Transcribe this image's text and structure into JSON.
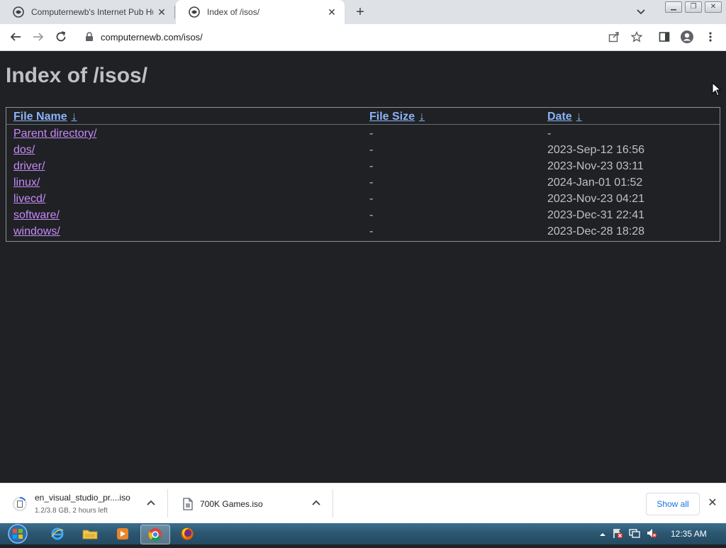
{
  "browser": {
    "tabs": [
      {
        "title": "Computernewb's Internet Pub Hub",
        "active": false
      },
      {
        "title": "Index of /isos/",
        "active": true
      }
    ],
    "url": "computernewb.com/isos/"
  },
  "page": {
    "heading": "Index of /isos/",
    "columns": {
      "name": "File Name",
      "size": "File Size",
      "date": "Date",
      "sort_arrow": "↓"
    },
    "rows": [
      {
        "name": "Parent directory/",
        "size": "-",
        "date": "-"
      },
      {
        "name": "dos/",
        "size": "-",
        "date": "2023-Sep-12 16:56"
      },
      {
        "name": "driver/",
        "size": "-",
        "date": "2023-Nov-23 03:11"
      },
      {
        "name": "linux/",
        "size": "-",
        "date": "2024-Jan-01 01:52"
      },
      {
        "name": "livecd/",
        "size": "-",
        "date": "2023-Nov-23 04:21"
      },
      {
        "name": "software/",
        "size": "-",
        "date": "2023-Dec-31 22:41"
      },
      {
        "name": "windows/",
        "size": "-",
        "date": "2023-Dec-28 18:28"
      }
    ]
  },
  "downloads": {
    "items": [
      {
        "name": "en_visual_studio_pr....iso",
        "status": "1.2/3.8 GB, 2 hours left"
      },
      {
        "name": "700K Games.iso",
        "status": ""
      }
    ],
    "show_all": "Show all"
  },
  "taskbar": {
    "clock": "12:35 AM",
    "apps": [
      "start-orb",
      "internet-explorer",
      "file-explorer",
      "media-player",
      "chrome",
      "firefox"
    ]
  },
  "colors": {
    "page_bg": "#202124",
    "link": "#8ab4f8",
    "visited_link": "#c58af9",
    "text": "#bdc1c6"
  }
}
